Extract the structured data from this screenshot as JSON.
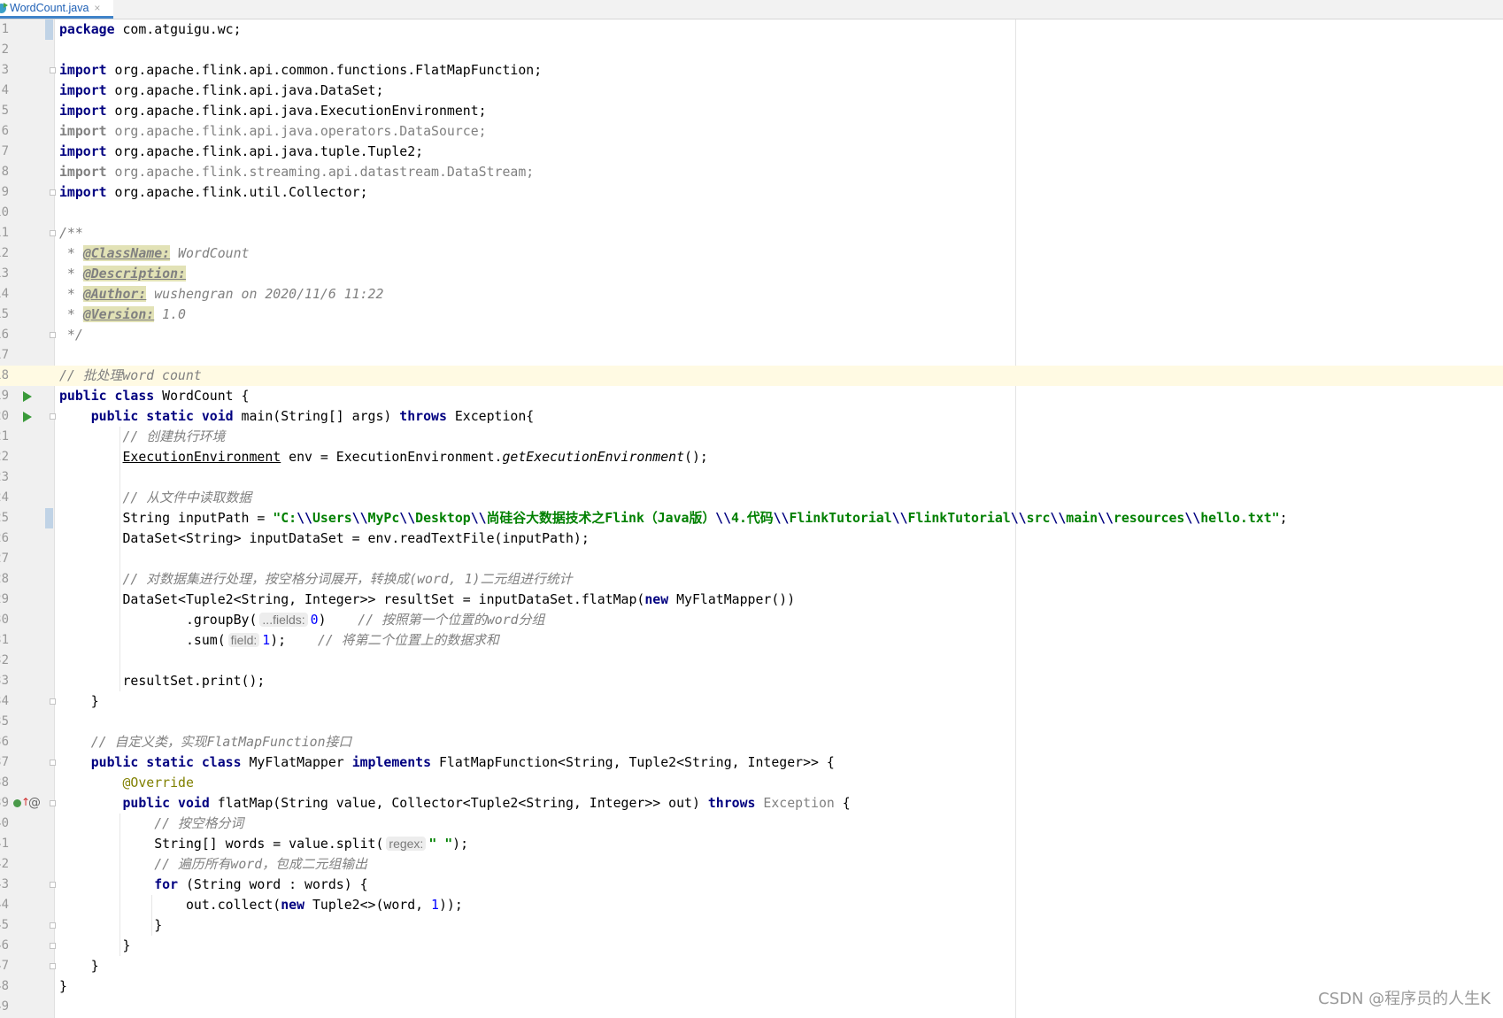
{
  "tab": {
    "title": "WordCount.java",
    "close": "×"
  },
  "watermark": "CSDN @程序员的人生K",
  "current_line": 18,
  "lines": [
    [
      [
        "k",
        "package"
      ],
      [
        "p",
        " com.atguigu.wc;"
      ]
    ],
    [],
    [
      [
        "k",
        "import"
      ],
      [
        "p",
        " org.apache.flink.api.common.functions.FlatMapFunction;"
      ]
    ],
    [
      [
        "k",
        "import"
      ],
      [
        "p",
        " org.apache.flink.api.java.DataSet;"
      ]
    ],
    [
      [
        "k",
        "import"
      ],
      [
        "p",
        " org.apache.flink.api.java.ExecutionEnvironment;"
      ]
    ],
    [
      [
        "gk",
        "import"
      ],
      [
        "g",
        " org.apache.flink.api.java.operators.DataSource;"
      ]
    ],
    [
      [
        "k",
        "import"
      ],
      [
        "p",
        " org.apache.flink.api.java.tuple.Tuple2;"
      ]
    ],
    [
      [
        "gk",
        "import"
      ],
      [
        "g",
        " org.apache.flink.streaming.api.datastream.DataStream;"
      ]
    ],
    [
      [
        "k",
        "import"
      ],
      [
        "p",
        " org.apache.flink.util.Collector;"
      ]
    ],
    [],
    [
      [
        "c",
        "/**"
      ]
    ],
    [
      [
        "c",
        " * "
      ],
      [
        "d",
        "@ClassName:"
      ],
      [
        "c",
        " WordCount"
      ]
    ],
    [
      [
        "c",
        " * "
      ],
      [
        "d",
        "@Description:"
      ]
    ],
    [
      [
        "c",
        " * "
      ],
      [
        "d",
        "@Author:"
      ],
      [
        "c",
        " wushengran on 2020/11/6 11:22"
      ]
    ],
    [
      [
        "c",
        " * "
      ],
      [
        "d",
        "@Version:"
      ],
      [
        "c",
        " 1.0"
      ]
    ],
    [
      [
        "c",
        " */"
      ]
    ],
    [],
    [
      [
        "c",
        "// 批处理word count"
      ]
    ],
    [
      [
        "k",
        "public class"
      ],
      [
        "p",
        " WordCount {"
      ]
    ],
    [
      [
        "p",
        "    "
      ],
      [
        "k",
        "public static void"
      ],
      [
        "p",
        " main(String[] args) "
      ],
      [
        "k",
        "throws"
      ],
      [
        "p",
        " Exception{"
      ]
    ],
    [
      [
        "p",
        "        "
      ],
      [
        "c",
        "// 创建执行环境"
      ]
    ],
    [
      [
        "p",
        "        "
      ],
      [
        "u",
        "ExecutionEnvironment"
      ],
      [
        "p",
        " env = ExecutionEnvironment."
      ],
      [
        "i",
        "getExecutionEnvironment"
      ],
      [
        "p",
        "();"
      ]
    ],
    [],
    [
      [
        "p",
        "        "
      ],
      [
        "c",
        "// 从文件中读取数据"
      ]
    ],
    [
      [
        "p",
        "        String inputPath = "
      ],
      [
        "s",
        "\"C:"
      ],
      [
        "e",
        "\\\\"
      ],
      [
        "s",
        "Users"
      ],
      [
        "e",
        "\\\\"
      ],
      [
        "s",
        "MyPc"
      ],
      [
        "e",
        "\\\\"
      ],
      [
        "s",
        "Desktop"
      ],
      [
        "e",
        "\\\\"
      ],
      [
        "s",
        "尚硅谷大数据技术之Flink（Java版）"
      ],
      [
        "e",
        "\\\\"
      ],
      [
        "s",
        "4.代码"
      ],
      [
        "e",
        "\\\\"
      ],
      [
        "s",
        "FlinkTutorial"
      ],
      [
        "e",
        "\\\\"
      ],
      [
        "s",
        "FlinkTutorial"
      ],
      [
        "e",
        "\\\\"
      ],
      [
        "s",
        "src"
      ],
      [
        "e",
        "\\\\"
      ],
      [
        "s",
        "main"
      ],
      [
        "e",
        "\\\\"
      ],
      [
        "s",
        "resources"
      ],
      [
        "e",
        "\\\\"
      ],
      [
        "s",
        "hello.txt\""
      ],
      [
        "p",
        ";"
      ]
    ],
    [
      [
        "p",
        "        DataSet<String> inputDataSet = env.readTextFile(inputPath);"
      ]
    ],
    [],
    [
      [
        "p",
        "        "
      ],
      [
        "c",
        "// 对数据集进行处理，按空格分词展开，转换成(word, 1)二元组进行统计"
      ]
    ],
    [
      [
        "p",
        "        DataSet<Tuple2<String, Integer>> resultSet = inputDataSet.flatMap("
      ],
      [
        "k",
        "new"
      ],
      [
        "p",
        " MyFlatMapper())"
      ]
    ],
    [
      [
        "p",
        "                .groupBy("
      ],
      [
        "h",
        "...fields:"
      ],
      [
        "n",
        "0"
      ],
      [
        "p",
        ")    "
      ],
      [
        "c",
        "// 按照第一个位置的word分组"
      ]
    ],
    [
      [
        "p",
        "                .sum("
      ],
      [
        "h",
        "field:"
      ],
      [
        "n",
        "1"
      ],
      [
        "p",
        ");    "
      ],
      [
        "c",
        "// 将第二个位置上的数据求和"
      ]
    ],
    [],
    [
      [
        "p",
        "        resultSet.print();"
      ]
    ],
    [
      [
        "p",
        "    }"
      ]
    ],
    [],
    [
      [
        "p",
        "    "
      ],
      [
        "c",
        "// 自定义类，实现FlatMapFunction接口"
      ]
    ],
    [
      [
        "p",
        "    "
      ],
      [
        "k",
        "public static class"
      ],
      [
        "p",
        " MyFlatMapper "
      ],
      [
        "k",
        "implements"
      ],
      [
        "p",
        " FlatMapFunction<String, Tuple2<String, Integer>> {"
      ]
    ],
    [
      [
        "p",
        "        "
      ],
      [
        "a",
        "@Override"
      ]
    ],
    [
      [
        "p",
        "        "
      ],
      [
        "k",
        "public void"
      ],
      [
        "p",
        " flatMap(String value, Collector<Tuple2<String, Integer>> out) "
      ],
      [
        "k",
        "throws"
      ],
      [
        "g",
        " Exception"
      ],
      [
        "p",
        " {"
      ]
    ],
    [
      [
        "p",
        "            "
      ],
      [
        "c",
        "// 按空格分词"
      ]
    ],
    [
      [
        "p",
        "            String[] words = value.split("
      ],
      [
        "h",
        "regex:"
      ],
      [
        "s",
        "\" \""
      ],
      [
        "p",
        ");"
      ]
    ],
    [
      [
        "p",
        "            "
      ],
      [
        "c",
        "// 遍历所有word，包成二元组输出"
      ]
    ],
    [
      [
        "p",
        "            "
      ],
      [
        "k",
        "for"
      ],
      [
        "p",
        " (String word : words) {"
      ]
    ],
    [
      [
        "p",
        "                out.collect("
      ],
      [
        "k",
        "new"
      ],
      [
        "p",
        " Tuple2<>(word, "
      ],
      [
        "n",
        "1"
      ],
      [
        "p",
        "));"
      ]
    ],
    [
      [
        "p",
        "            }"
      ]
    ],
    [
      [
        "p",
        "        }"
      ]
    ],
    [
      [
        "p",
        "    }"
      ]
    ],
    [
      [
        "p",
        "}"
      ]
    ],
    []
  ],
  "gutter": {
    "run_lines": [
      19,
      20
    ],
    "override_lines": [
      39
    ],
    "changed_lines": [
      1,
      25
    ],
    "fold_lines": [
      3,
      9,
      11,
      16,
      20,
      34,
      37,
      39,
      43,
      45,
      46,
      47
    ]
  }
}
